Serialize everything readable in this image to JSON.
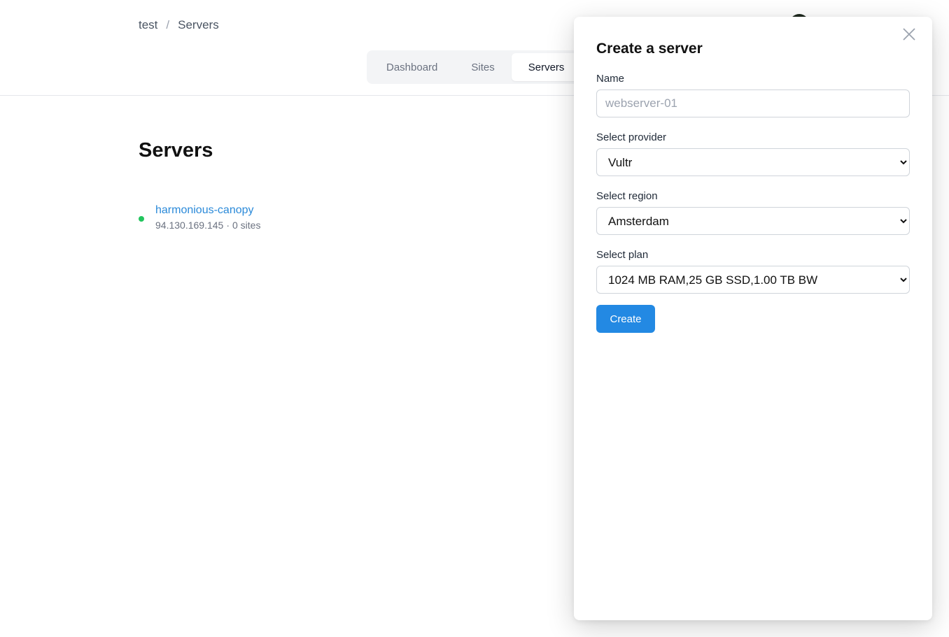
{
  "breadcrumb": {
    "items": [
      "test",
      "Servers"
    ],
    "separator": "/"
  },
  "nav": {
    "tabs": [
      "Dashboard",
      "Sites",
      "Servers"
    ],
    "active": "Servers"
  },
  "page": {
    "title": "Servers"
  },
  "servers": [
    {
      "name": "harmonious-canopy",
      "ip": "94.130.169.145",
      "separator": "·",
      "sites": "0 sites",
      "status_color": "#22c55e"
    }
  ],
  "drawer": {
    "title": "Create a server",
    "name_label": "Name",
    "name_placeholder": "webserver-01",
    "provider_label": "Select provider",
    "provider_value": "Vultr",
    "region_label": "Select region",
    "region_value": "Amsterdam",
    "plan_label": "Select plan",
    "plan_value": "1024 MB RAM,25 GB SSD,1.00 TB BW",
    "create_label": "Create",
    "close_icon": "close-icon"
  },
  "colors": {
    "accent": "#2389e3",
    "link": "#2b8ad9",
    "status_online": "#22c55e"
  }
}
